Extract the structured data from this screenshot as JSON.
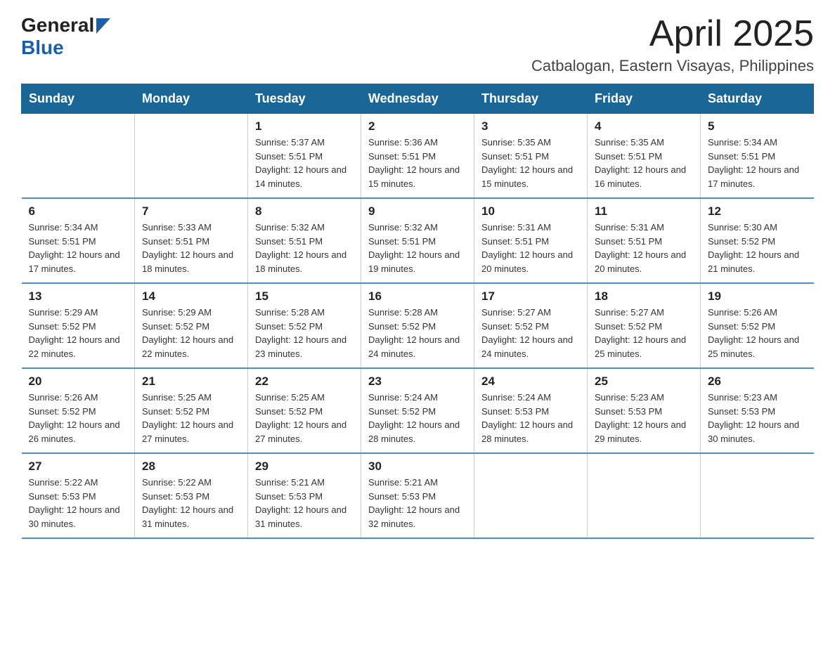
{
  "logo": {
    "text_general": "General",
    "text_blue": "Blue"
  },
  "header": {
    "title": "April 2025",
    "subtitle": "Catbalogan, Eastern Visayas, Philippines"
  },
  "weekdays": [
    "Sunday",
    "Monday",
    "Tuesday",
    "Wednesday",
    "Thursday",
    "Friday",
    "Saturday"
  ],
  "weeks": [
    [
      {
        "day": "",
        "sunrise": "",
        "sunset": "",
        "daylight": ""
      },
      {
        "day": "",
        "sunrise": "",
        "sunset": "",
        "daylight": ""
      },
      {
        "day": "1",
        "sunrise": "Sunrise: 5:37 AM",
        "sunset": "Sunset: 5:51 PM",
        "daylight": "Daylight: 12 hours and 14 minutes."
      },
      {
        "day": "2",
        "sunrise": "Sunrise: 5:36 AM",
        "sunset": "Sunset: 5:51 PM",
        "daylight": "Daylight: 12 hours and 15 minutes."
      },
      {
        "day": "3",
        "sunrise": "Sunrise: 5:35 AM",
        "sunset": "Sunset: 5:51 PM",
        "daylight": "Daylight: 12 hours and 15 minutes."
      },
      {
        "day": "4",
        "sunrise": "Sunrise: 5:35 AM",
        "sunset": "Sunset: 5:51 PM",
        "daylight": "Daylight: 12 hours and 16 minutes."
      },
      {
        "day": "5",
        "sunrise": "Sunrise: 5:34 AM",
        "sunset": "Sunset: 5:51 PM",
        "daylight": "Daylight: 12 hours and 17 minutes."
      }
    ],
    [
      {
        "day": "6",
        "sunrise": "Sunrise: 5:34 AM",
        "sunset": "Sunset: 5:51 PM",
        "daylight": "Daylight: 12 hours and 17 minutes."
      },
      {
        "day": "7",
        "sunrise": "Sunrise: 5:33 AM",
        "sunset": "Sunset: 5:51 PM",
        "daylight": "Daylight: 12 hours and 18 minutes."
      },
      {
        "day": "8",
        "sunrise": "Sunrise: 5:32 AM",
        "sunset": "Sunset: 5:51 PM",
        "daylight": "Daylight: 12 hours and 18 minutes."
      },
      {
        "day": "9",
        "sunrise": "Sunrise: 5:32 AM",
        "sunset": "Sunset: 5:51 PM",
        "daylight": "Daylight: 12 hours and 19 minutes."
      },
      {
        "day": "10",
        "sunrise": "Sunrise: 5:31 AM",
        "sunset": "Sunset: 5:51 PM",
        "daylight": "Daylight: 12 hours and 20 minutes."
      },
      {
        "day": "11",
        "sunrise": "Sunrise: 5:31 AM",
        "sunset": "Sunset: 5:51 PM",
        "daylight": "Daylight: 12 hours and 20 minutes."
      },
      {
        "day": "12",
        "sunrise": "Sunrise: 5:30 AM",
        "sunset": "Sunset: 5:52 PM",
        "daylight": "Daylight: 12 hours and 21 minutes."
      }
    ],
    [
      {
        "day": "13",
        "sunrise": "Sunrise: 5:29 AM",
        "sunset": "Sunset: 5:52 PM",
        "daylight": "Daylight: 12 hours and 22 minutes."
      },
      {
        "day": "14",
        "sunrise": "Sunrise: 5:29 AM",
        "sunset": "Sunset: 5:52 PM",
        "daylight": "Daylight: 12 hours and 22 minutes."
      },
      {
        "day": "15",
        "sunrise": "Sunrise: 5:28 AM",
        "sunset": "Sunset: 5:52 PM",
        "daylight": "Daylight: 12 hours and 23 minutes."
      },
      {
        "day": "16",
        "sunrise": "Sunrise: 5:28 AM",
        "sunset": "Sunset: 5:52 PM",
        "daylight": "Daylight: 12 hours and 24 minutes."
      },
      {
        "day": "17",
        "sunrise": "Sunrise: 5:27 AM",
        "sunset": "Sunset: 5:52 PM",
        "daylight": "Daylight: 12 hours and 24 minutes."
      },
      {
        "day": "18",
        "sunrise": "Sunrise: 5:27 AM",
        "sunset": "Sunset: 5:52 PM",
        "daylight": "Daylight: 12 hours and 25 minutes."
      },
      {
        "day": "19",
        "sunrise": "Sunrise: 5:26 AM",
        "sunset": "Sunset: 5:52 PM",
        "daylight": "Daylight: 12 hours and 25 minutes."
      }
    ],
    [
      {
        "day": "20",
        "sunrise": "Sunrise: 5:26 AM",
        "sunset": "Sunset: 5:52 PM",
        "daylight": "Daylight: 12 hours and 26 minutes."
      },
      {
        "day": "21",
        "sunrise": "Sunrise: 5:25 AM",
        "sunset": "Sunset: 5:52 PM",
        "daylight": "Daylight: 12 hours and 27 minutes."
      },
      {
        "day": "22",
        "sunrise": "Sunrise: 5:25 AM",
        "sunset": "Sunset: 5:52 PM",
        "daylight": "Daylight: 12 hours and 27 minutes."
      },
      {
        "day": "23",
        "sunrise": "Sunrise: 5:24 AM",
        "sunset": "Sunset: 5:52 PM",
        "daylight": "Daylight: 12 hours and 28 minutes."
      },
      {
        "day": "24",
        "sunrise": "Sunrise: 5:24 AM",
        "sunset": "Sunset: 5:53 PM",
        "daylight": "Daylight: 12 hours and 28 minutes."
      },
      {
        "day": "25",
        "sunrise": "Sunrise: 5:23 AM",
        "sunset": "Sunset: 5:53 PM",
        "daylight": "Daylight: 12 hours and 29 minutes."
      },
      {
        "day": "26",
        "sunrise": "Sunrise: 5:23 AM",
        "sunset": "Sunset: 5:53 PM",
        "daylight": "Daylight: 12 hours and 30 minutes."
      }
    ],
    [
      {
        "day": "27",
        "sunrise": "Sunrise: 5:22 AM",
        "sunset": "Sunset: 5:53 PM",
        "daylight": "Daylight: 12 hours and 30 minutes."
      },
      {
        "day": "28",
        "sunrise": "Sunrise: 5:22 AM",
        "sunset": "Sunset: 5:53 PM",
        "daylight": "Daylight: 12 hours and 31 minutes."
      },
      {
        "day": "29",
        "sunrise": "Sunrise: 5:21 AM",
        "sunset": "Sunset: 5:53 PM",
        "daylight": "Daylight: 12 hours and 31 minutes."
      },
      {
        "day": "30",
        "sunrise": "Sunrise: 5:21 AM",
        "sunset": "Sunset: 5:53 PM",
        "daylight": "Daylight: 12 hours and 32 minutes."
      },
      {
        "day": "",
        "sunrise": "",
        "sunset": "",
        "daylight": ""
      },
      {
        "day": "",
        "sunrise": "",
        "sunset": "",
        "daylight": ""
      },
      {
        "day": "",
        "sunrise": "",
        "sunset": "",
        "daylight": ""
      }
    ]
  ]
}
